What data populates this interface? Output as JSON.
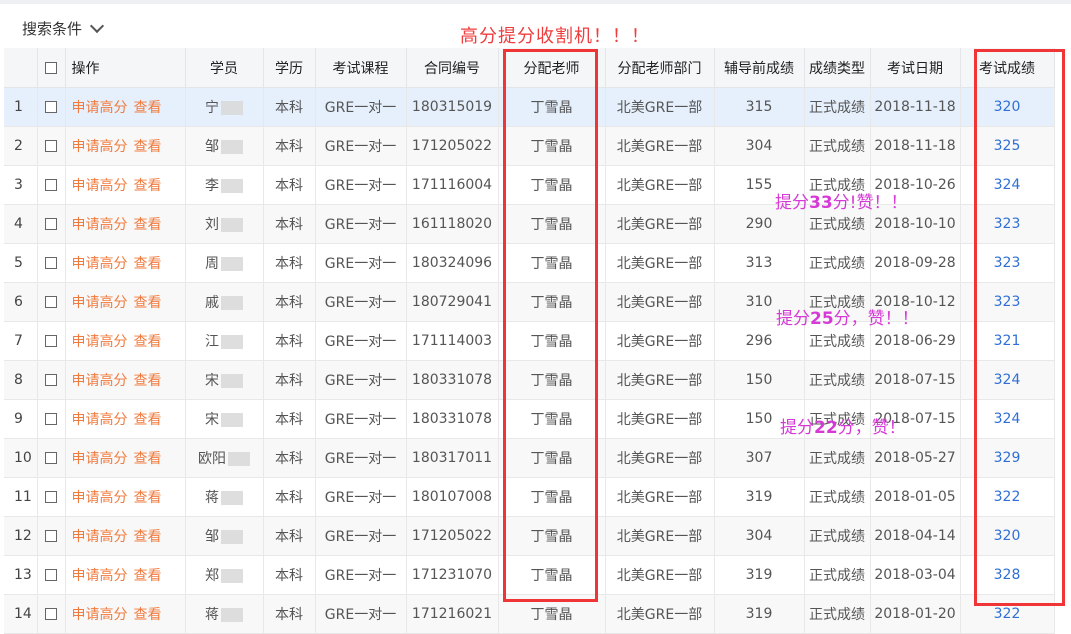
{
  "topbar": {
    "search_label": "搜索条件",
    "headline": "高分提分收割机！！！"
  },
  "table": {
    "columns": {
      "action": "操作",
      "student": "学员",
      "education": "学历",
      "course": "考试课程",
      "contract": "合同编号",
      "teacher": "分配老师",
      "dept": "分配老师部门",
      "pre_score": "辅导前成绩",
      "score_type": "成绩类型",
      "exam_date": "考试日期",
      "score": "考试成绩"
    },
    "action_labels": {
      "apply": "申请高分",
      "view": "查看"
    },
    "rows": [
      {
        "idx": "1",
        "student": "宁",
        "education": "本科",
        "course": "GRE一对一",
        "contract": "180315019",
        "teacher": "丁雪晶",
        "dept": "北美GRE一部",
        "pre_score": "315",
        "score_type": "正式成绩",
        "exam_date": "2018-11-18",
        "score": "320"
      },
      {
        "idx": "2",
        "student": "邹",
        "education": "本科",
        "course": "GRE一对一",
        "contract": "171205022",
        "teacher": "丁雪晶",
        "dept": "北美GRE一部",
        "pre_score": "304",
        "score_type": "正式成绩",
        "exam_date": "2018-11-18",
        "score": "325"
      },
      {
        "idx": "3",
        "student": "李",
        "education": "本科",
        "course": "GRE一对一",
        "contract": "171116004",
        "teacher": "丁雪晶",
        "dept": "北美GRE一部",
        "pre_score": "155",
        "score_type": "正式成绩",
        "exam_date": "2018-10-26",
        "score": "324"
      },
      {
        "idx": "4",
        "student": "刘",
        "education": "本科",
        "course": "GRE一对一",
        "contract": "161118020",
        "teacher": "丁雪晶",
        "dept": "北美GRE一部",
        "pre_score": "290",
        "score_type": "正式成绩",
        "exam_date": "2018-10-10",
        "score": "323"
      },
      {
        "idx": "5",
        "student": "周",
        "education": "本科",
        "course": "GRE一对一",
        "contract": "180324096",
        "teacher": "丁雪晶",
        "dept": "北美GRE一部",
        "pre_score": "313",
        "score_type": "正式成绩",
        "exam_date": "2018-09-28",
        "score": "323"
      },
      {
        "idx": "6",
        "student": "戚",
        "education": "本科",
        "course": "GRE一对一",
        "contract": "180729041",
        "teacher": "丁雪晶",
        "dept": "北美GRE一部",
        "pre_score": "310",
        "score_type": "正式成绩",
        "exam_date": "2018-10-12",
        "score": "323"
      },
      {
        "idx": "7",
        "student": "江",
        "education": "本科",
        "course": "GRE一对一",
        "contract": "171114003",
        "teacher": "丁雪晶",
        "dept": "北美GRE一部",
        "pre_score": "296",
        "score_type": "正式成绩",
        "exam_date": "2018-06-29",
        "score": "321"
      },
      {
        "idx": "8",
        "student": "宋",
        "education": "本科",
        "course": "GRE一对一",
        "contract": "180331078",
        "teacher": "丁雪晶",
        "dept": "北美GRE一部",
        "pre_score": "150",
        "score_type": "正式成绩",
        "exam_date": "2018-07-15",
        "score": "324"
      },
      {
        "idx": "9",
        "student": "宋",
        "education": "本科",
        "course": "GRE一对一",
        "contract": "180331078",
        "teacher": "丁雪晶",
        "dept": "北美GRE一部",
        "pre_score": "150",
        "score_type": "正式成绩",
        "exam_date": "2018-07-15",
        "score": "324"
      },
      {
        "idx": "10",
        "student": "欧阳",
        "education": "本科",
        "course": "GRE一对一",
        "contract": "180317011",
        "teacher": "丁雪晶",
        "dept": "北美GRE一部",
        "pre_score": "307",
        "score_type": "正式成绩",
        "exam_date": "2018-05-27",
        "score": "329"
      },
      {
        "idx": "11",
        "student": "蒋",
        "education": "本科",
        "course": "GRE一对一",
        "contract": "180107008",
        "teacher": "丁雪晶",
        "dept": "北美GRE一部",
        "pre_score": "319",
        "score_type": "正式成绩",
        "exam_date": "2018-01-05",
        "score": "322"
      },
      {
        "idx": "12",
        "student": "邹",
        "education": "本科",
        "course": "GRE一对一",
        "contract": "171205022",
        "teacher": "丁雪晶",
        "dept": "北美GRE一部",
        "pre_score": "304",
        "score_type": "正式成绩",
        "exam_date": "2018-04-14",
        "score": "320"
      },
      {
        "idx": "13",
        "student": "郑",
        "education": "本科",
        "course": "GRE一对一",
        "contract": "171231070",
        "teacher": "丁雪晶",
        "dept": "北美GRE一部",
        "pre_score": "319",
        "score_type": "正式成绩",
        "exam_date": "2018-03-04",
        "score": "328"
      },
      {
        "idx": "14",
        "student": "蒋",
        "education": "本科",
        "course": "GRE一对一",
        "contract": "171216021",
        "teacher": "丁雪晶",
        "dept": "北美GRE一部",
        "pre_score": "319",
        "score_type": "正式成绩",
        "exam_date": "2018-01-20",
        "score": "322"
      }
    ]
  },
  "annotations": {
    "note1_prefix": "提分",
    "note1_num": "33",
    "note1_suffix": "分!赞！！",
    "note2_prefix": "提分",
    "note2_num": "25",
    "note2_suffix": "分，赞！！",
    "note3_prefix": "提分",
    "note3_num": "22",
    "note3_suffix": "分，赞！"
  },
  "colors": {
    "highlight_frame": "#ef3535",
    "headline": "#f03c3c",
    "note": "#d63ad6",
    "action_link": "#f07b3f",
    "score_link": "#2f6fd6",
    "selected_row": "#e6f0fc"
  }
}
